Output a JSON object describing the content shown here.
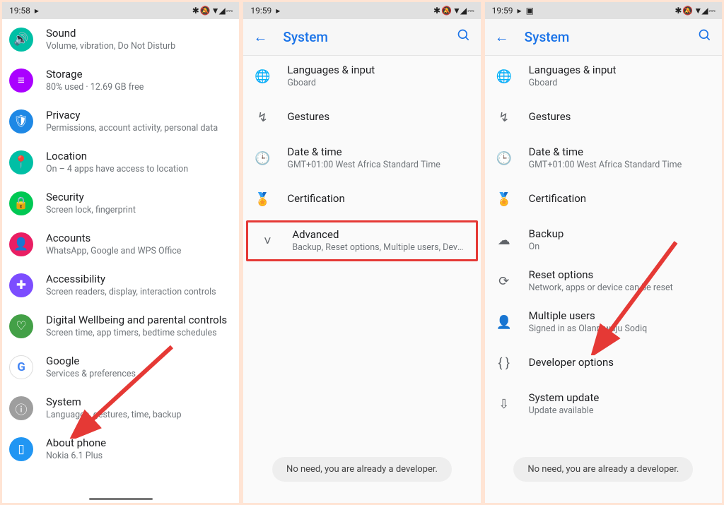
{
  "statusIconsA": "✱ 🔕 ▼◢ ⎓",
  "statusIconsB": "✱ 🔕 ▼◢ ⎓",
  "statusIconsC": "✱ 🔕 ▼◢ ⎓",
  "panel1": {
    "time": "19:58",
    "items": [
      {
        "title": "Sound",
        "sub": "Volume, vibration, Do Not Disturb",
        "iconClass": "i-teal",
        "glyph": "🔊"
      },
      {
        "title": "Storage",
        "sub": "80% used · 12.69 GB free",
        "iconClass": "i-purple",
        "glyph": "≡"
      },
      {
        "title": "Privacy",
        "sub": "Permissions, account activity, personal data",
        "iconClass": "i-blue",
        "glyph": "🛡"
      },
      {
        "title": "Location",
        "sub": "On – 4 apps have access to location",
        "iconClass": "i-teal",
        "glyph": "📍"
      },
      {
        "title": "Security",
        "sub": "Screen lock, fingerprint",
        "iconClass": "i-green",
        "glyph": "🔒"
      },
      {
        "title": "Accounts",
        "sub": "WhatsApp, Google and WPS Office",
        "iconClass": "i-pink",
        "glyph": "👤"
      },
      {
        "title": "Accessibility",
        "sub": "Screen readers, display, interaction controls",
        "iconClass": "i-deep",
        "glyph": "✚"
      },
      {
        "title": "Digital Wellbeing and parental controls",
        "sub": "Screen time, app timers, bedtime schedules",
        "iconClass": "i-lime",
        "glyph": "♡"
      },
      {
        "title": "Google",
        "sub": "Services & preferences",
        "iconClass": "",
        "glyph": "G"
      },
      {
        "title": "System",
        "sub": "Languages, gestures, time, backup",
        "iconClass": "i-grey",
        "glyph": "ⓘ"
      },
      {
        "title": "About phone",
        "sub": "Nokia 6.1 Plus",
        "iconClass": "i-lblue",
        "glyph": "▯"
      }
    ]
  },
  "panel2": {
    "time": "19:59",
    "header": "System",
    "items": [
      {
        "title": "Languages & input",
        "sub": "Gboard",
        "glyph": "🌐"
      },
      {
        "title": "Gestures",
        "sub": "",
        "glyph": "↯"
      },
      {
        "title": "Date & time",
        "sub": "GMT+01:00 West Africa Standard Time",
        "glyph": "🕒"
      },
      {
        "title": "Certification",
        "sub": "",
        "glyph": "🏅"
      },
      {
        "title": "Advanced",
        "sub": "Backup, Reset options, Multiple users, Developer o..",
        "glyph": "˅",
        "highlight": true
      }
    ],
    "toast": "No need, you are already a developer."
  },
  "panel3": {
    "time": "19:59",
    "header": "System",
    "items": [
      {
        "title": "Languages & input",
        "sub": "Gboard",
        "glyph": "🌐"
      },
      {
        "title": "Gestures",
        "sub": "",
        "glyph": "↯"
      },
      {
        "title": "Date & time",
        "sub": "GMT+01:00 West Africa Standard Time",
        "glyph": "🕒"
      },
      {
        "title": "Certification",
        "sub": "",
        "glyph": "🏅"
      },
      {
        "title": "Backup",
        "sub": "On",
        "glyph": "☁"
      },
      {
        "title": "Reset options",
        "sub": "Network, apps or device can be reset",
        "glyph": "⟳"
      },
      {
        "title": "Multiple users",
        "sub": "Signed in as Olanrewaju Sodiq",
        "glyph": "👤"
      },
      {
        "title": "Developer options",
        "sub": "",
        "glyph": "{ }"
      },
      {
        "title": "System update",
        "sub": "Update available",
        "glyph": "⇩"
      }
    ],
    "toast": "No need, you are already a developer."
  }
}
